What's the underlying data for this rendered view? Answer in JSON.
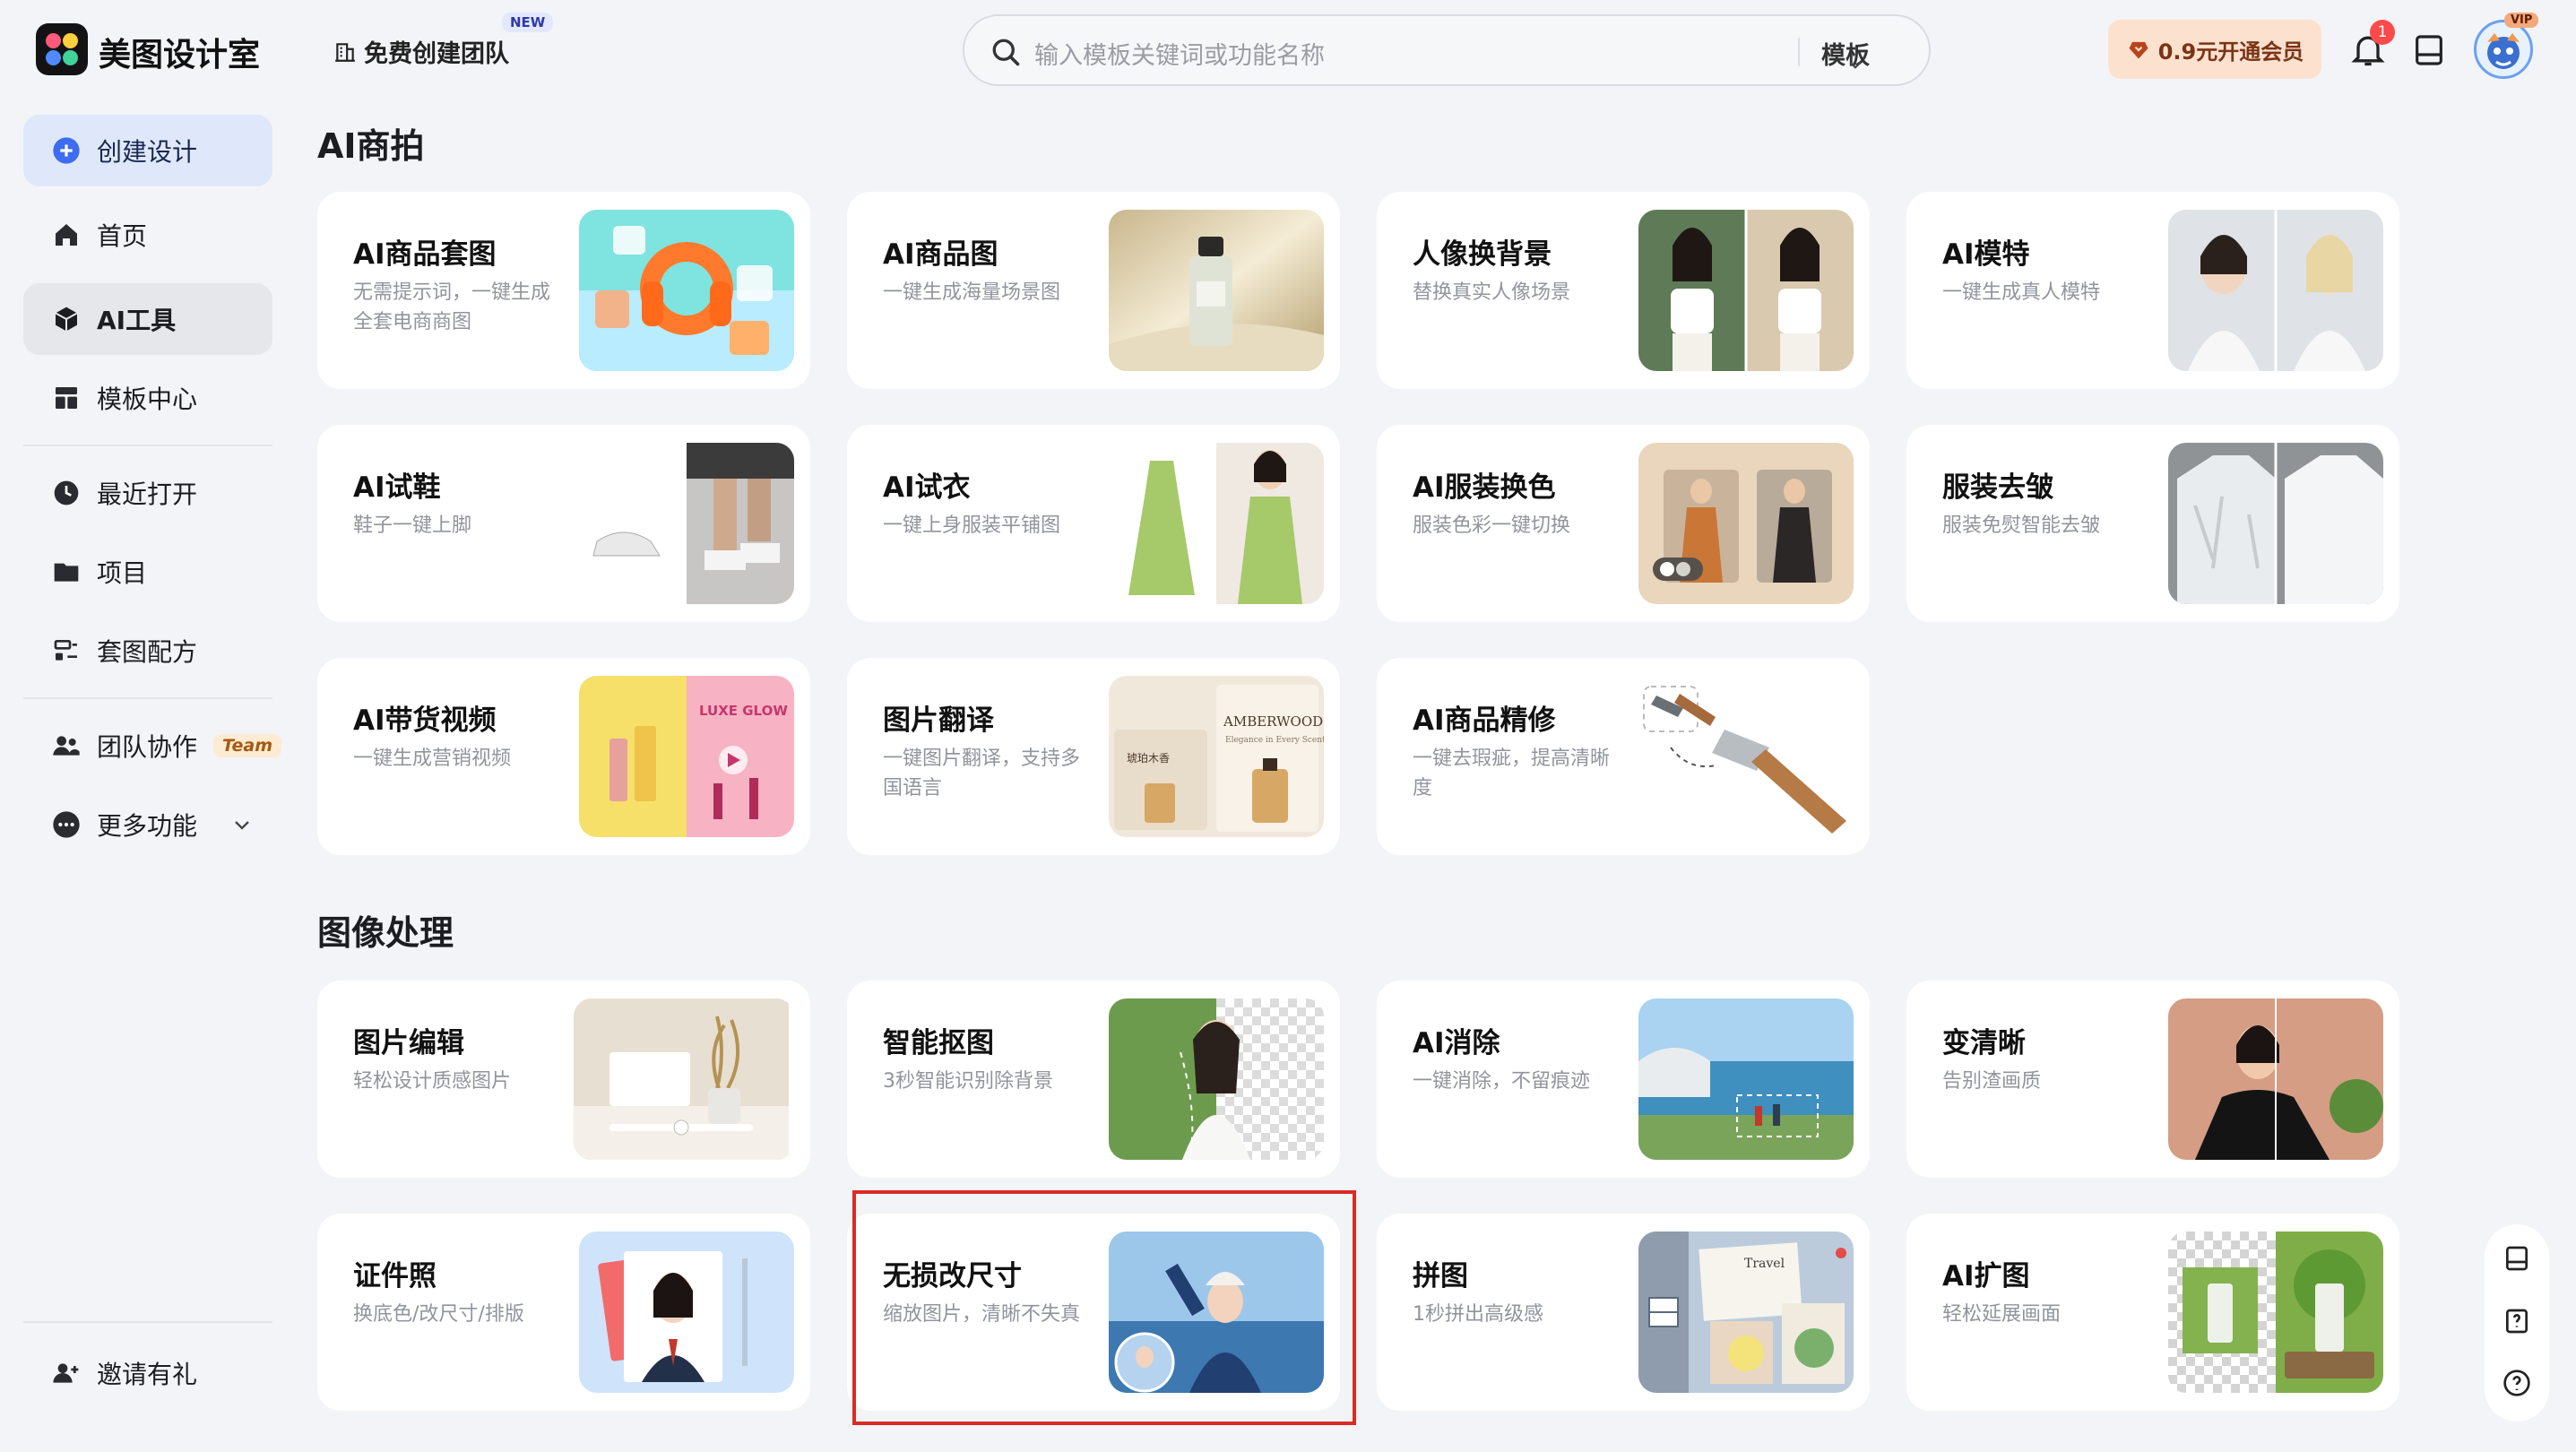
{
  "app": {
    "brand": "美图设计室",
    "team_create": "免费创建团队",
    "new_badge": "NEW"
  },
  "search": {
    "placeholder": "输入模板关键词或功能名称",
    "scope": "模板"
  },
  "header": {
    "vip_button": "0.9元开通会员",
    "notification_count": "1",
    "vip_tag": "VIP"
  },
  "sidebar": {
    "create": "创建设计",
    "items": [
      {
        "label": "首页",
        "icon": "home-icon"
      },
      {
        "label": "AI工具",
        "icon": "cube-icon"
      },
      {
        "label": "模板中心",
        "icon": "template-icon"
      },
      {
        "label": "最近打开",
        "icon": "clock-icon"
      },
      {
        "label": "项目",
        "icon": "folder-icon"
      },
      {
        "label": "套图配方",
        "icon": "recipe-icon"
      },
      {
        "label": "团队协作",
        "icon": "team-icon",
        "badge": "Team"
      },
      {
        "label": "更多功能",
        "icon": "more-icon"
      }
    ],
    "invite": "邀请有礼"
  },
  "sections": [
    {
      "title": "AI商拍",
      "cards": [
        {
          "title": "AI商品套图",
          "desc": "无需提示词，一键生成全套电商商图"
        },
        {
          "title": "AI商品图",
          "desc": "一键生成海量场景图"
        },
        {
          "title": "人像换背景",
          "desc": "替换真实人像场景"
        },
        {
          "title": "AI模特",
          "desc": "一键生成真人模特"
        },
        {
          "title": "AI试鞋",
          "desc": "鞋子一键上脚"
        },
        {
          "title": "AI试衣",
          "desc": "一键上身服装平铺图"
        },
        {
          "title": "AI服装换色",
          "desc": "服装色彩一键切换"
        },
        {
          "title": "服装去皱",
          "desc": "服装免熨智能去皱"
        },
        {
          "title": "AI带货视频",
          "desc": "一键生成营销视频"
        },
        {
          "title": "图片翻译",
          "desc": "一键图片翻译，支持多国语言"
        },
        {
          "title": "AI商品精修",
          "desc": "一键去瑕疵，提高清晰度"
        }
      ]
    },
    {
      "title": "图像处理",
      "cards": [
        {
          "title": "图片编辑",
          "desc": "轻松设计质感图片"
        },
        {
          "title": "智能抠图",
          "desc": "3秒智能识别除背景"
        },
        {
          "title": "AI消除",
          "desc": "一键消除，不留痕迹"
        },
        {
          "title": "变清晰",
          "desc": "告别渣画质"
        },
        {
          "title": "证件照",
          "desc": "换底色/改尺寸/排版"
        },
        {
          "title": "无损改尺寸",
          "desc": "缩放图片，清晰不失真"
        },
        {
          "title": "拼图",
          "desc": "1秒拼出高级感"
        },
        {
          "title": "AI扩图",
          "desc": "轻松延展画面"
        }
      ]
    }
  ],
  "thumb_text": {
    "luxe": "LUXE GLOW",
    "amberwood": "AMBERWOOD",
    "amberwood_sub": "Elegance in Every Scent",
    "amberwood_cn": "琥珀木香",
    "travel": "Travel"
  }
}
